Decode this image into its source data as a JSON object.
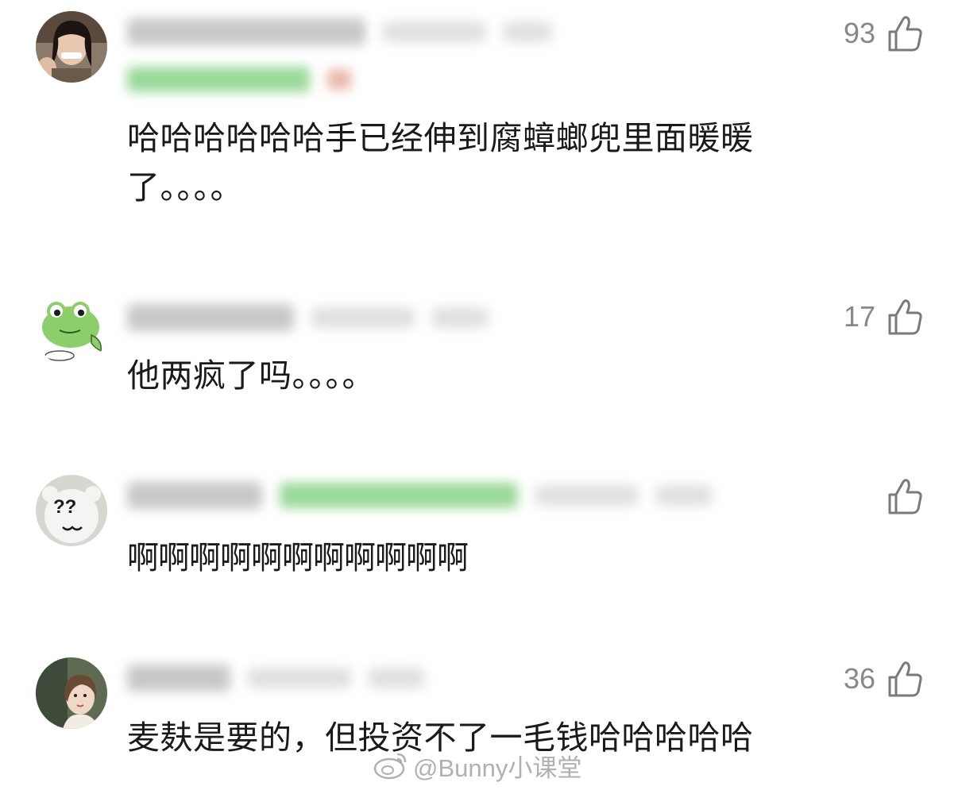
{
  "comments": [
    {
      "text": "哈哈哈哈哈哈手已经伸到腐蟑螂兜里面暖暖了。。。。",
      "likes": "93",
      "avatar": "woman-laughing-avatar"
    },
    {
      "text": "他两疯了吗。。。。",
      "likes": "17",
      "avatar": "cartoon-frog-avatar"
    },
    {
      "text": "啊啊啊啊啊啊啊啊啊啊啊",
      "likes": "",
      "avatar": "question-mark-bear-avatar"
    },
    {
      "text": "麦麸是要的，但投资不了一毛钱哈哈哈哈哈",
      "likes": "36",
      "avatar": "girl-selfie-avatar"
    }
  ],
  "watermark": {
    "text": "@Bunny小课堂",
    "icon": "weibo-logo-icon"
  },
  "colors": {
    "text": "#1a1a1a",
    "like_count": "#888888",
    "blurred_badge": "#9ad99a"
  }
}
